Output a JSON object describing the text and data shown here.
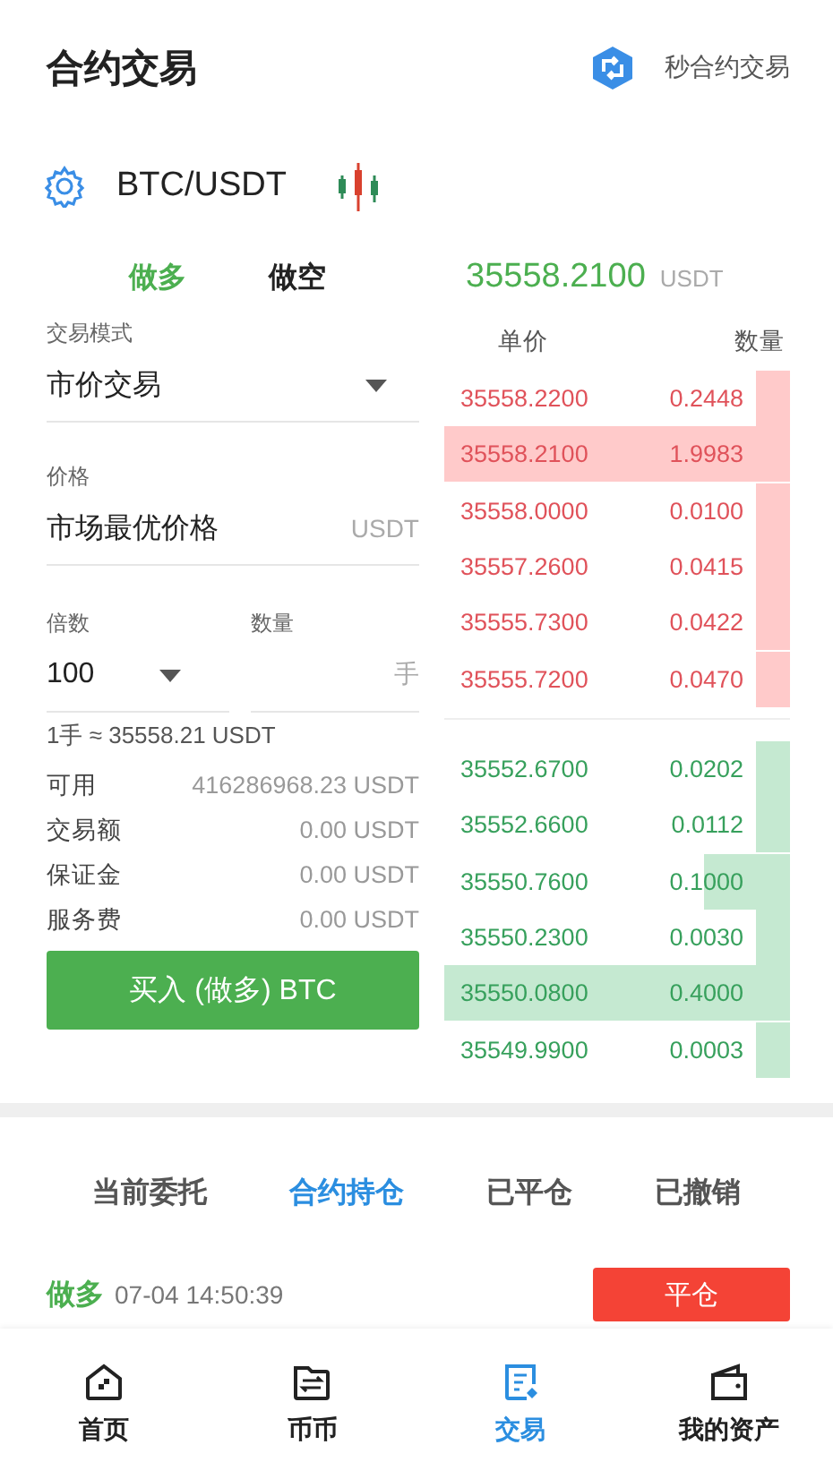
{
  "header": {
    "title": "合约交易",
    "link": "秒合约交易"
  },
  "pair": {
    "symbol": "BTC/USDT"
  },
  "side_tabs": [
    {
      "label": "做多",
      "selected": true
    },
    {
      "label": "做空",
      "selected": false
    }
  ],
  "last_price": {
    "value": "35558.2100",
    "unit": "USDT"
  },
  "form": {
    "mode_label": "交易模式",
    "mode_value": "市价交易",
    "price_label": "价格",
    "price_value": "市场最优价格",
    "price_unit": "USDT",
    "leverage_label": "倍数",
    "leverage_value": "100",
    "quantity_label": "数量",
    "quantity_unit": "手",
    "lot_note": "1手 ≈ 35558.21 USDT"
  },
  "summary": [
    {
      "label": "可用",
      "value": "416286968.23 USDT"
    },
    {
      "label": "交易额",
      "value": "0.00 USDT"
    },
    {
      "label": "保证金",
      "value": "0.00 USDT"
    },
    {
      "label": "服务费",
      "value": "0.00 USDT"
    }
  ],
  "buy_button": "买入 (做多) BTC",
  "order_book": {
    "columns": [
      "单价",
      "数量"
    ],
    "asks": [
      {
        "price": "35558.2200",
        "amount": "0.2448",
        "kind": "narrow"
      },
      {
        "price": "35558.2100",
        "amount": "1.9983",
        "kind": "full"
      },
      {
        "price": "35558.0000",
        "amount": "0.0100",
        "kind": "narrow"
      },
      {
        "price": "35557.2600",
        "amount": "0.0415",
        "kind": "narrow"
      },
      {
        "price": "35555.7300",
        "amount": "0.0422",
        "kind": "narrow"
      },
      {
        "price": "35555.7200",
        "amount": "0.0470",
        "kind": "narrow"
      }
    ],
    "bids": [
      {
        "price": "35552.6700",
        "amount": "0.0202",
        "kind": "narrow"
      },
      {
        "price": "35552.6600",
        "amount": "0.0112",
        "kind": "narrow"
      },
      {
        "price": "35550.7600",
        "amount": "0.1000",
        "kind": "medium"
      },
      {
        "price": "35550.2300",
        "amount": "0.0030",
        "kind": "narrow"
      },
      {
        "price": "35550.0800",
        "amount": "0.4000",
        "kind": "full"
      },
      {
        "price": "35549.9900",
        "amount": "0.0003",
        "kind": "narrow"
      }
    ]
  },
  "order_tabs": [
    {
      "label": "当前委托",
      "selected": false
    },
    {
      "label": "合约持仓",
      "selected": true
    },
    {
      "label": "已平仓",
      "selected": false
    },
    {
      "label": "已撤销",
      "selected": false
    }
  ],
  "positions": [
    {
      "side": "做多",
      "time": "07-04 14:50:39",
      "action": "平仓"
    }
  ],
  "nav": [
    {
      "kind": "home",
      "label": "首页",
      "selected": false
    },
    {
      "kind": "exchange",
      "label": "币币",
      "selected": false
    },
    {
      "kind": "trade",
      "label": "交易",
      "selected": true
    },
    {
      "kind": "wallet",
      "label": "我的资产",
      "selected": false
    }
  ]
}
